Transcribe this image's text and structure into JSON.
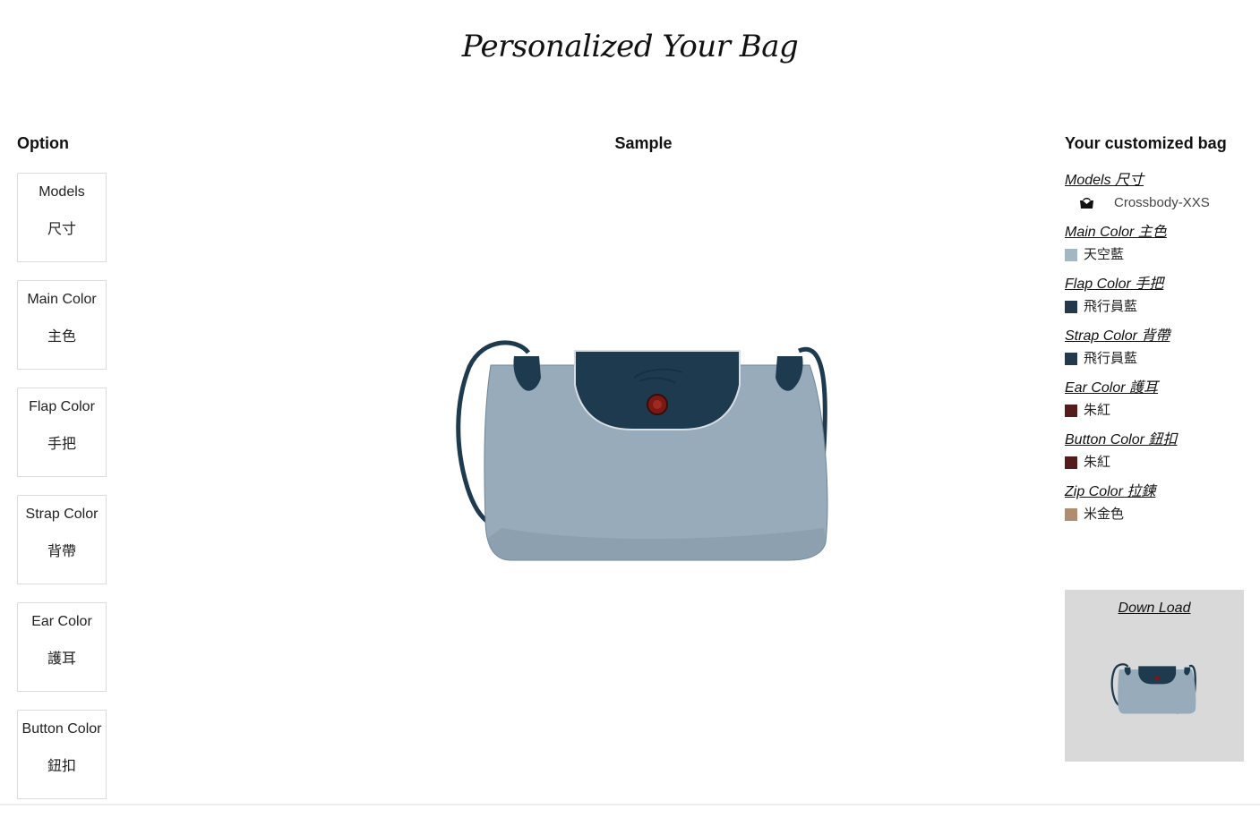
{
  "page": {
    "title": "Personalized Your Bag"
  },
  "headings": {
    "option": "Option",
    "sample": "Sample",
    "custom": "Your customized bag"
  },
  "options": [
    {
      "en": "Models",
      "zh": "尺寸"
    },
    {
      "en": "Main Color",
      "zh": "主色"
    },
    {
      "en": "Flap Color",
      "zh": "手把"
    },
    {
      "en": "Strap Color",
      "zh": "背帶"
    },
    {
      "en": "Ear Color",
      "zh": "護耳"
    },
    {
      "en": "Button Color",
      "zh": "鈕扣"
    }
  ],
  "summary": {
    "model": {
      "title": "Models 尺寸",
      "value": "Crossbody-XXS",
      "icon": "bag-model-icon"
    },
    "main": {
      "title": "Main Color 主色",
      "value": "天空藍",
      "color": "#a3b6c4"
    },
    "flap": {
      "title": "Flap Color 手把",
      "value": "飛行員藍",
      "color": "#233a4d"
    },
    "strap": {
      "title": "Strap Color 背帶",
      "value": "飛行員藍",
      "color": "#233a4d"
    },
    "ear": {
      "title": "Ear Color 護耳",
      "value": "朱紅",
      "color": "#561b1b"
    },
    "button": {
      "title": "Button Color 鈕扣",
      "value": "朱紅",
      "color": "#561b1b"
    },
    "zip": {
      "title": "Zip Color 拉鍊",
      "value": "米金色",
      "color": "#b08d6e"
    }
  },
  "download": {
    "label": "Down Load"
  },
  "colors": {
    "body": "#97abba",
    "flap": "#1d3a4f",
    "strap": "#1d3a4f",
    "button": "#7b1a14"
  }
}
